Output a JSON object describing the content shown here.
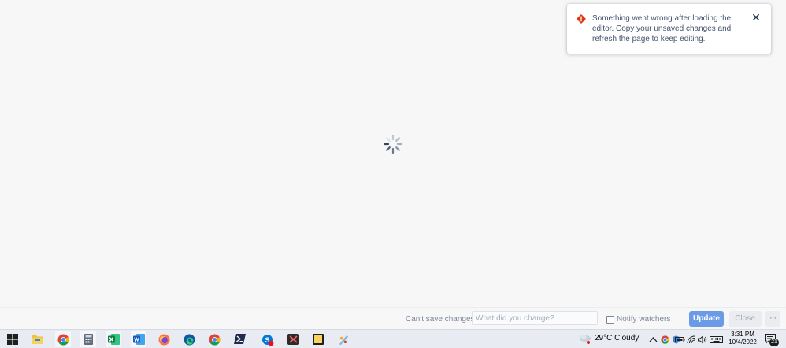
{
  "toast": {
    "message": "Something went wrong after loading the editor. Copy your unsaved changes and refresh the page to keep editing.",
    "icon": "error-icon",
    "close_icon": "close-icon",
    "close_symbol": "✕"
  },
  "loading": {
    "icon": "loading-spinner-icon"
  },
  "footer": {
    "status_text": "Can't save changes",
    "change_placeholder": "What did you change?",
    "change_value": "",
    "notify_label": "Notify watchers",
    "notify_checked": false,
    "update_label": "Update",
    "close_label": "Close",
    "more_label": "···"
  },
  "taskbar": {
    "apps": [
      {
        "name": "windows-start-icon"
      },
      {
        "name": "file-explorer-icon"
      },
      {
        "name": "chrome-icon"
      },
      {
        "name": "calculator-icon"
      },
      {
        "name": "excel-icon"
      },
      {
        "name": "word-icon"
      },
      {
        "name": "firefox-icon"
      },
      {
        "name": "edge-icon"
      },
      {
        "name": "chrome-alt-icon"
      },
      {
        "name": "powershell-icon"
      },
      {
        "name": "skype-icon"
      },
      {
        "name": "snipping-tool-icon"
      },
      {
        "name": "sticky-notes-icon"
      },
      {
        "name": "paint-icon"
      }
    ],
    "weather": {
      "temperature": "29°C",
      "condition": "Cloudy"
    },
    "tray": [
      "chevron-up-icon",
      "chrome-tray-icon",
      "shield-tray-icon",
      "battery-icon",
      "wifi-icon",
      "volume-icon",
      "keyboard-icon"
    ],
    "clock": {
      "time": "3:31 PM",
      "date": "10/4/2022"
    },
    "notifications": {
      "count": "21"
    }
  }
}
